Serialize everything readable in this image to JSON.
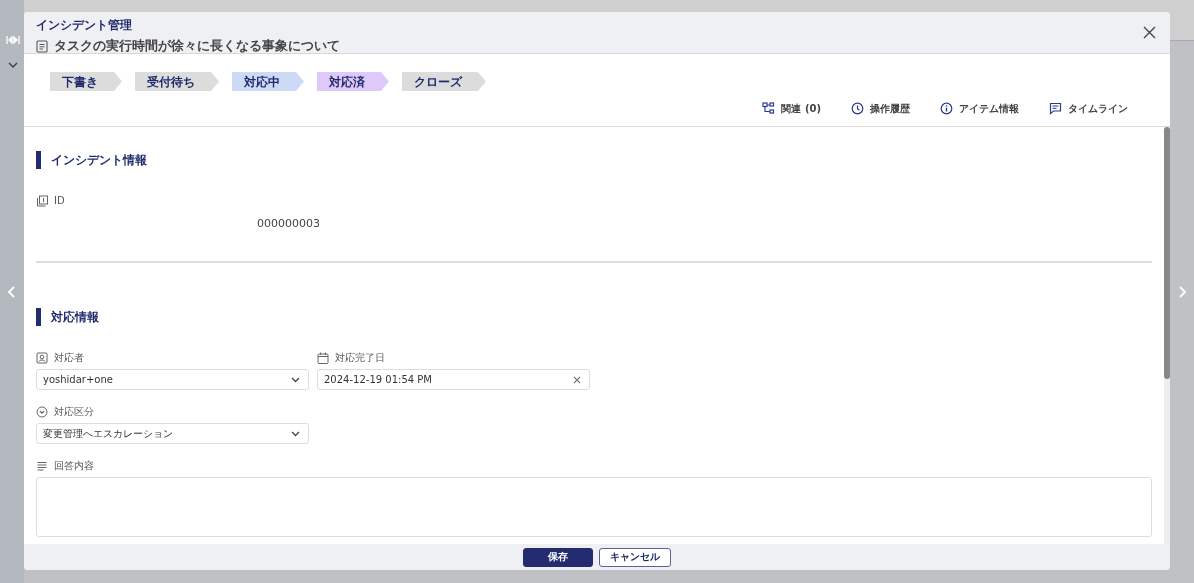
{
  "dialog": {
    "module": "インシデント管理",
    "title": "タスクの実行時間が徐々に長くなる事象について"
  },
  "steps": [
    {
      "label": "下書き",
      "color": "#dcdcdc"
    },
    {
      "label": "受付待ち",
      "color": "#dcdcdc"
    },
    {
      "label": "対応中",
      "color": "#cddaf6"
    },
    {
      "label": "対応済",
      "color": "#dfc9fb"
    },
    {
      "label": "クローズ",
      "color": "#dcdcdc"
    }
  ],
  "actions": [
    {
      "label": "関連 (0)",
      "kind": "related"
    },
    {
      "label": "操作履歴",
      "kind": "history"
    },
    {
      "label": "アイテム情報",
      "kind": "info"
    },
    {
      "label": "タイムライン",
      "kind": "timeline"
    }
  ],
  "sections": [
    {
      "title": "インシデント情報",
      "fields": [
        {
          "kind": "readonly",
          "label": "ID",
          "value": "000000003"
        }
      ]
    },
    {
      "title": "対応情報",
      "fields": [
        {
          "kind": "select",
          "label": "対応者",
          "value": "yoshidar+one"
        },
        {
          "kind": "date",
          "label": "対応完了日",
          "value": "2024-12-19 01:54 PM"
        },
        {
          "kind": "select",
          "label": "対応区分",
          "value": "変更管理へエスカレーション"
        },
        {
          "kind": "textarea",
          "label": "回答内容"
        }
      ]
    }
  ],
  "footer": {
    "buttons": [
      {
        "label": "保存",
        "kind": "primary"
      },
      {
        "label": "キャンセル",
        "kind": "secondary"
      }
    ]
  }
}
